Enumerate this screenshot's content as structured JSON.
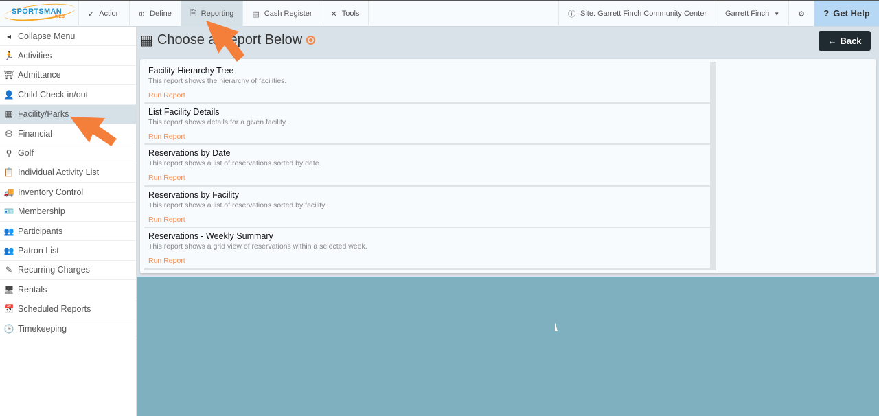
{
  "header": {
    "logo_text": "SPORTSMAN",
    "logo_sub": "WEB",
    "nav": [
      {
        "label": "Action",
        "icon": "check-icon"
      },
      {
        "label": "Define",
        "icon": "plus-circle-icon"
      },
      {
        "label": "Reporting",
        "icon": "document-icon"
      },
      {
        "label": "Cash Register",
        "icon": "cash-register-icon"
      },
      {
        "label": "Tools",
        "icon": "tools-icon"
      }
    ],
    "site": "Site: Garrett Finch Community Center",
    "user": "Garrett Finch",
    "help": "Get Help"
  },
  "sidebar": {
    "items": [
      {
        "label": "Collapse Menu"
      },
      {
        "label": "Activities"
      },
      {
        "label": "Admittance"
      },
      {
        "label": "Child Check-in/out"
      },
      {
        "label": "Facility/Parks"
      },
      {
        "label": "Financial"
      },
      {
        "label": "Golf"
      },
      {
        "label": "Individual Activity List"
      },
      {
        "label": "Inventory Control"
      },
      {
        "label": "Membership"
      },
      {
        "label": "Participants"
      },
      {
        "label": "Patron List"
      },
      {
        "label": "Recurring Charges"
      },
      {
        "label": "Rentals"
      },
      {
        "label": "Scheduled Reports"
      },
      {
        "label": "Timekeeping"
      }
    ]
  },
  "main": {
    "title": "Choose a Report Below",
    "back": "Back",
    "run_label": "Run Report",
    "reports": [
      {
        "name": "Facility Hierarchy Tree",
        "desc": "This report shows the hierarchy of facilities."
      },
      {
        "name": "List Facility Details",
        "desc": "This report shows details for a given facility."
      },
      {
        "name": "Reservations by Date",
        "desc": "This report shows a list of reservations sorted by date."
      },
      {
        "name": "Reservations by Facility",
        "desc": "This report shows a list of reservations sorted by facility."
      },
      {
        "name": "Reservations - Weekly Summary",
        "desc": "This report shows a grid view of reservations within a selected week."
      }
    ]
  },
  "colors": {
    "accent": "#f28a4b",
    "teal": "#7fb0bf",
    "dark": "#1f2a31"
  }
}
